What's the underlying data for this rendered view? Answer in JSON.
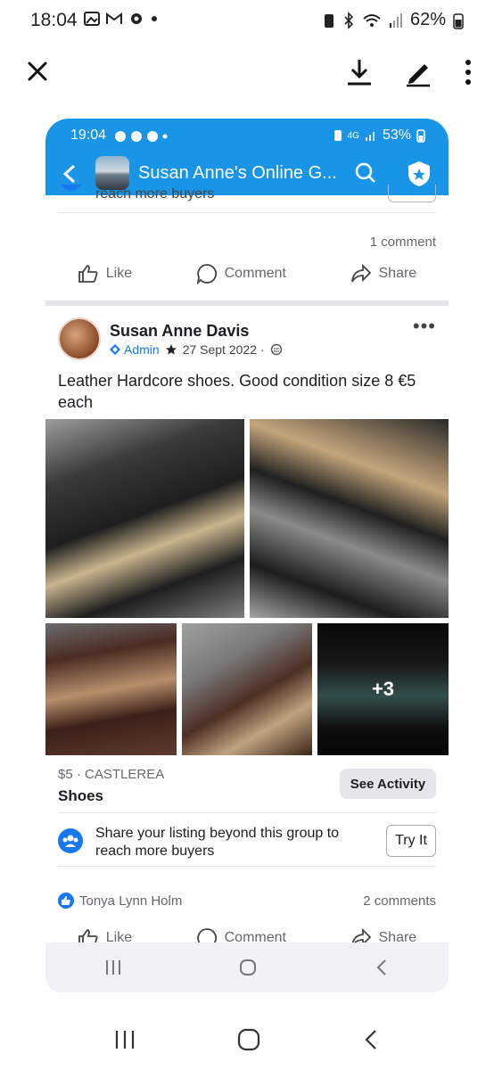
{
  "outer_status": {
    "time": "18:04",
    "battery": "62%"
  },
  "inner_status": {
    "time": "19:04",
    "battery": "53%",
    "network": "4G"
  },
  "header": {
    "title": "Susan Anne's Online G..."
  },
  "previous_post": {
    "share_text_fragment": "reach more buyers",
    "comments": "1 comment"
  },
  "actions": {
    "like": "Like",
    "comment": "Comment",
    "share": "Share"
  },
  "post": {
    "author": "Susan Anne Davis",
    "role": "Admin",
    "date": "27 Sept 2022 ·",
    "text": "Leather Hardcore shoes. Good condition size 8 €5 each",
    "more_photos": "+3",
    "price_location": "$5 · CASTLEREA",
    "listing_title": "Shoes",
    "see_activity": "See Activity",
    "share_listing": "Share your listing beyond this group to reach more buyers",
    "try_it": "Try It",
    "reactor": "Tonya Lynn Holm",
    "comments": "2 comments"
  }
}
